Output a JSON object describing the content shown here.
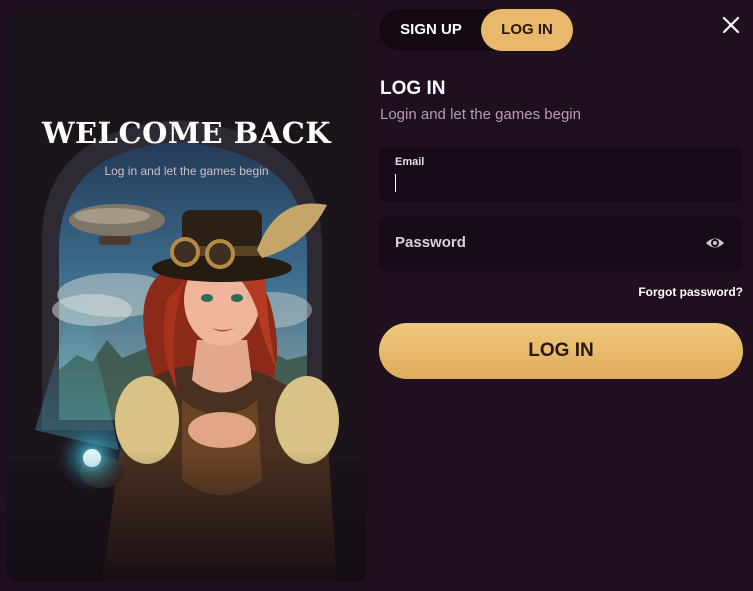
{
  "promo": {
    "title": "WELCOME BACK",
    "subtitle": "Log in and let the games begin"
  },
  "tabs": [
    {
      "label": "SIGN UP",
      "active": false
    },
    {
      "label": "LOG IN",
      "active": true
    }
  ],
  "form": {
    "title": "LOG IN",
    "subtitle": "Login and let the games begin",
    "email_label": "Email",
    "email_value": "",
    "password_placeholder": "Password",
    "forgot_link": "Forgot password?",
    "submit_label": "LOG IN"
  },
  "icons": {
    "close": "close-icon",
    "eye": "eye-icon"
  },
  "colors": {
    "background": "#1f0f1f",
    "accent": "#e8b86b",
    "field_bg": "#170b17",
    "subtitle_text": "#b79bb3"
  }
}
